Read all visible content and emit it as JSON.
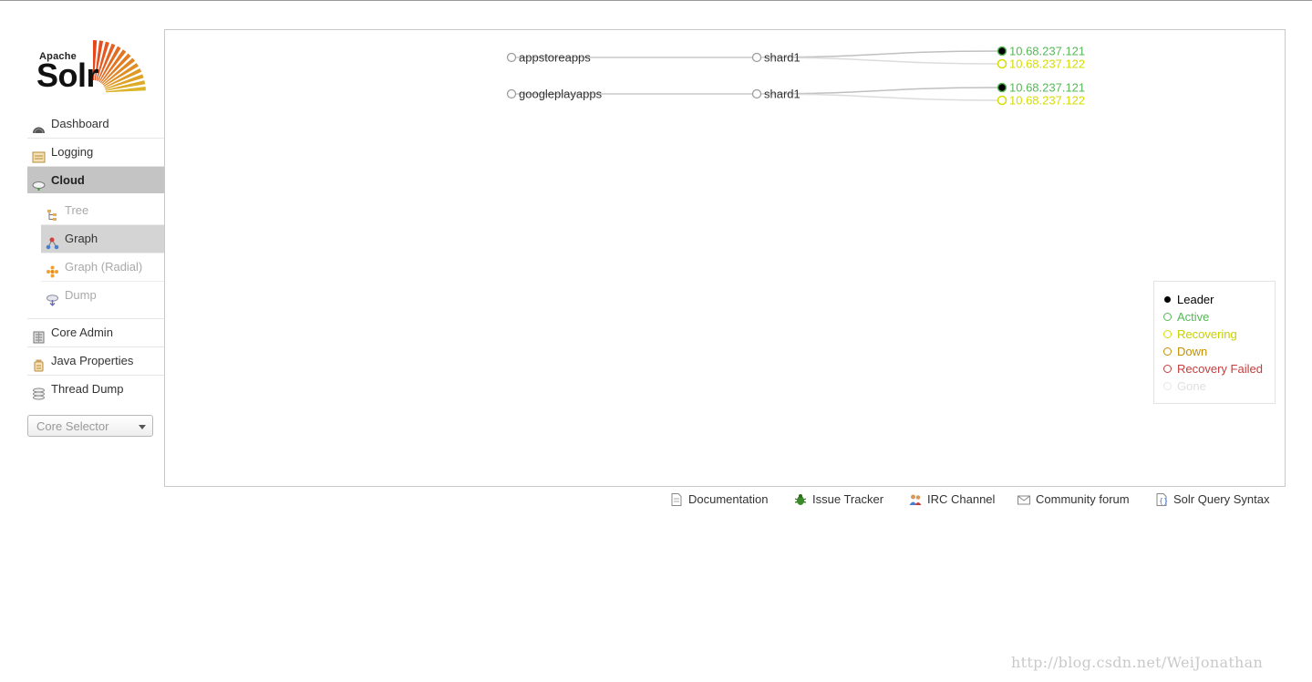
{
  "logo": {
    "apache": "Apache",
    "solr": "Solr"
  },
  "nav": {
    "dashboard": "Dashboard",
    "logging": "Logging",
    "cloud": "Cloud",
    "tree": "Tree",
    "graph": "Graph",
    "graph_radial": "Graph (Radial)",
    "dump": "Dump",
    "core_admin": "Core Admin",
    "java_properties": "Java Properties",
    "thread_dump": "Thread Dump"
  },
  "core_selector": {
    "placeholder": "Core Selector"
  },
  "graph": {
    "collections": [
      {
        "name": "appstoreapps",
        "shards": [
          {
            "name": "shard1",
            "replicas": [
              {
                "host": "10.68.237.121",
                "state": "leader-active"
              },
              {
                "host": "10.68.237.122",
                "state": "recovering"
              }
            ]
          }
        ]
      },
      {
        "name": "googleplayapps",
        "shards": [
          {
            "name": "shard1",
            "replicas": [
              {
                "host": "10.68.237.121",
                "state": "leader-active"
              },
              {
                "host": "10.68.237.122",
                "state": "recovering"
              }
            ]
          }
        ]
      }
    ]
  },
  "legend": {
    "leader": "Leader",
    "active": "Active",
    "recovering": "Recovering",
    "down": "Down",
    "recovery_failed": "Recovery Failed",
    "gone": "Gone"
  },
  "colors": {
    "leader": "#000000",
    "active": "#57b757",
    "recovering": "#d5dd00",
    "down": "#c48f00",
    "recovery_failed": "#c53d3d",
    "gone": "#e0e0e0"
  },
  "footer": {
    "documentation": "Documentation",
    "issue_tracker": "Issue Tracker",
    "irc_channel": "IRC Channel",
    "community_forum": "Community forum",
    "query_syntax": "Solr Query Syntax"
  },
  "watermark": "http://blog.csdn.net/WeiJonathan"
}
